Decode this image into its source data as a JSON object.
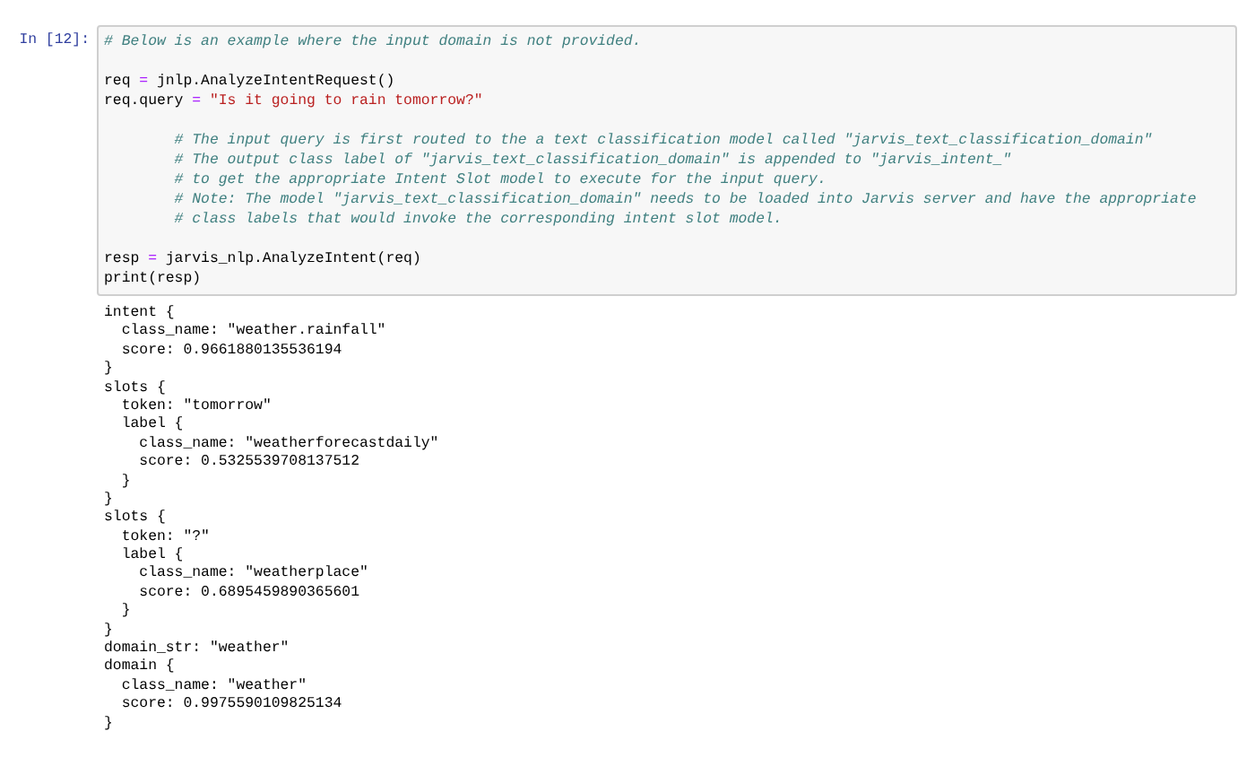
{
  "cell": {
    "prompt": "In [12]:",
    "code_lines": [
      {
        "kind": "code",
        "indented": false,
        "segments": [
          {
            "kind": "comment",
            "text": "# Below is an example where the input domain is not provided."
          }
        ]
      },
      {
        "kind": "blank"
      },
      {
        "kind": "code",
        "indented": false,
        "segments": [
          {
            "kind": "plain",
            "text": "req"
          },
          {
            "kind": "operator",
            "text": "="
          },
          {
            "kind": "plain",
            "text": "jnlp.AnalyzeIntentRequest()"
          }
        ]
      },
      {
        "kind": "code",
        "indented": false,
        "segments": [
          {
            "kind": "plain",
            "text": "req.query"
          },
          {
            "kind": "operator",
            "text": "="
          },
          {
            "kind": "string",
            "text": "\"Is it going to rain tomorrow?\""
          }
        ]
      },
      {
        "kind": "blank"
      },
      {
        "kind": "code",
        "indented": true,
        "segments": [
          {
            "kind": "comment",
            "text": "# The input query is first routed to the a text classification model called \"jarvis_text_classification_domain\""
          }
        ]
      },
      {
        "kind": "code",
        "indented": true,
        "segments": [
          {
            "kind": "comment",
            "text": "# The output class label of \"jarvis_text_classification_domain\" is appended to \"jarvis_intent_\""
          }
        ]
      },
      {
        "kind": "code",
        "indented": true,
        "segments": [
          {
            "kind": "comment",
            "text": "# to get the appropriate Intent Slot model to execute for the input query."
          }
        ]
      },
      {
        "kind": "code",
        "indented": true,
        "segments": [
          {
            "kind": "comment",
            "text": "# Note: The model \"jarvis_text_classification_domain\" needs to be loaded into Jarvis server and have the appropriate"
          }
        ]
      },
      {
        "kind": "code",
        "indented": true,
        "segments": [
          {
            "kind": "comment",
            "text": "# class labels that would invoke the corresponding intent slot model."
          }
        ]
      },
      {
        "kind": "blank"
      },
      {
        "kind": "code",
        "indented": false,
        "segments": [
          {
            "kind": "plain",
            "text": "resp"
          },
          {
            "kind": "operator",
            "text": "="
          },
          {
            "kind": "plain",
            "text": "jarvis_nlp.AnalyzeIntent(req)"
          }
        ]
      },
      {
        "kind": "code",
        "indented": false,
        "segments": [
          {
            "kind": "plain",
            "text": "print(resp)"
          }
        ]
      }
    ],
    "output_lines": [
      "intent {",
      "  class_name: \"weather.rainfall\"",
      "  score: 0.9661880135536194",
      "}",
      "slots {",
      "  token: \"tomorrow\"",
      "  label {",
      "    class_name: \"weatherforecastdaily\"",
      "    score: 0.5325539708137512",
      "  }",
      "}",
      "slots {",
      "  token: \"?\"",
      "  label {",
      "    class_name: \"weatherplace\"",
      "    score: 0.6895459890365601",
      "  }",
      "}",
      "domain_str: \"weather\"",
      "domain {",
      "  class_name: \"weather\"",
      "  score: 0.9975590109825134",
      "}"
    ]
  }
}
